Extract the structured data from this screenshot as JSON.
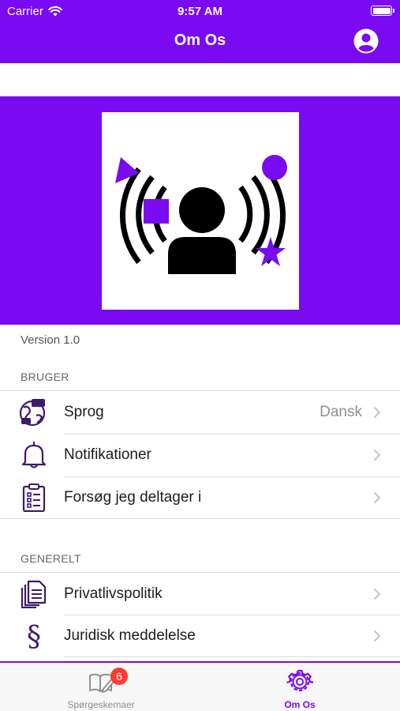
{
  "status_bar": {
    "carrier": "Carrier",
    "time": "9:57 AM"
  },
  "nav": {
    "title": "Om Os",
    "profile_icon": "account-circle-icon"
  },
  "hero": {
    "logo": "person-broadcast-shapes-logo"
  },
  "version_text": "Version 1.0",
  "sections": {
    "user": {
      "header": "BRUGER",
      "items": [
        {
          "label": "Sprog",
          "value": "Dansk",
          "icon": "globe-chat-icon"
        },
        {
          "label": "Notifikationer",
          "icon": "bell-icon"
        },
        {
          "label": "Forsøg jeg deltager i",
          "icon": "clipboard-checklist-icon"
        }
      ]
    },
    "general": {
      "header": "GENERELT",
      "items": [
        {
          "label": "Privatlivspolitik",
          "icon": "documents-icon"
        },
        {
          "label": "Juridisk meddelelse",
          "icon": "section-sign-icon"
        }
      ]
    }
  },
  "tabbar": {
    "tabs": [
      {
        "label": "Spørgeskemaer",
        "badge": "6",
        "icon": "book-edit-icon",
        "active": false
      },
      {
        "label": "Om Os",
        "icon": "gear-icon",
        "active": true
      }
    ]
  },
  "colors": {
    "accent": "#7a0af2",
    "badge": "#ff3b30",
    "inactive": "#8e8e93"
  }
}
